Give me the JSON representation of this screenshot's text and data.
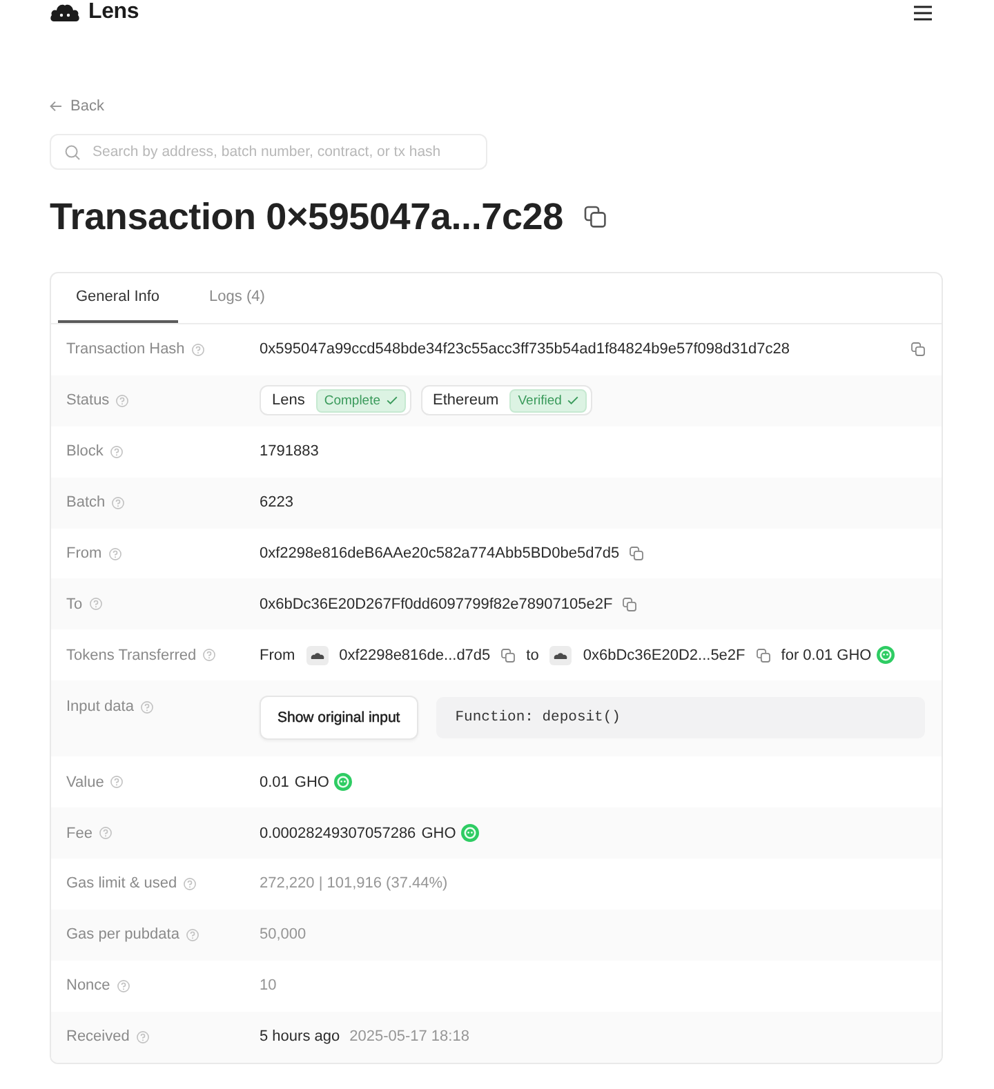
{
  "header": {
    "logo_text": "Lens"
  },
  "back_link": {
    "label": "Back"
  },
  "search": {
    "placeholder": "Search by address, batch number, contract, or tx hash"
  },
  "page_title": "Transaction 0×595047a...7c28",
  "tabs": [
    {
      "label": "General Info",
      "selected": true
    },
    {
      "label": "Logs (4)",
      "selected": false
    }
  ],
  "details": [
    {
      "kind": "hash",
      "label": "Transaction Hash",
      "value": "0x595047a99ccd548bde34f23c55acc3ff735b54ad1f84824b9e57f098d31d7c28"
    },
    {
      "kind": "status",
      "label": "Status",
      "badges": [
        {
          "network": "Lens",
          "status": "Complete"
        },
        {
          "network": "Ethereum",
          "status": "Verified"
        }
      ]
    },
    {
      "kind": "text",
      "label": "Block",
      "value": "1791883"
    },
    {
      "kind": "text",
      "label": "Batch",
      "value": "6223"
    },
    {
      "kind": "address",
      "label": "From",
      "value": "0xf2298e816deB6AAe20c582a774Abb5BD0be5d7d5"
    },
    {
      "kind": "address",
      "label": "To",
      "value": "0x6bDc36E20D267Ff0dd6097799f82e78907105e2F"
    },
    {
      "kind": "transfer",
      "label": "Tokens Transferred",
      "from_label": "From",
      "from": "0xf2298e816de...d7d5",
      "to_label": "to",
      "to": "0x6bDc36E20D2...5e2F",
      "amount": "for 0.01 GHO"
    },
    {
      "kind": "input",
      "label": "Input data",
      "button": "Show original input",
      "code": "Function: deposit()"
    },
    {
      "kind": "amount",
      "label": "Value",
      "amount": "0.01",
      "token": "GHO"
    },
    {
      "kind": "amount",
      "label": "Fee",
      "amount": "0.00028249307057286",
      "token": "GHO"
    },
    {
      "kind": "muted",
      "label": "Gas limit & used",
      "value": "272,220 | 101,916 (37.44%)"
    },
    {
      "kind": "muted",
      "label": "Gas per pubdata",
      "value": "50,000"
    },
    {
      "kind": "muted",
      "label": "Nonce",
      "value": "10"
    },
    {
      "kind": "time",
      "label": "Received",
      "relative": "5 hours ago",
      "absolute": "2025-05-17 18:18"
    }
  ]
}
